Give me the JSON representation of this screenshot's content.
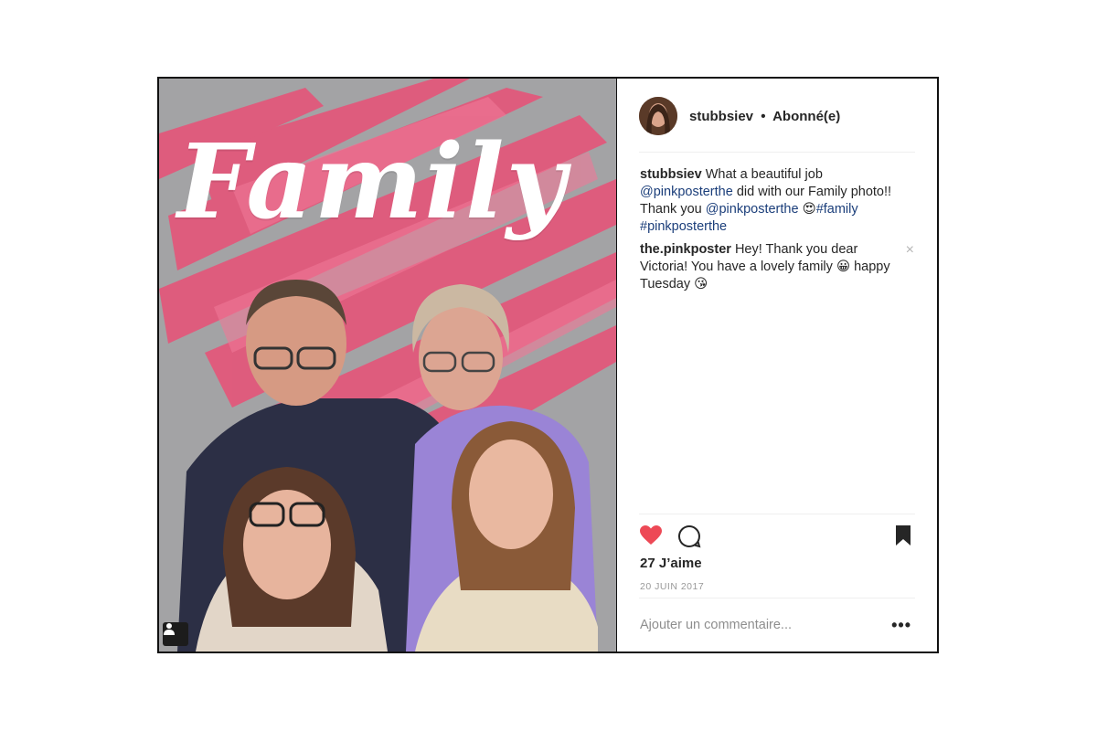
{
  "post": {
    "header": {
      "username": "stubbsiev",
      "separator": "•",
      "follow_status": "Abonné(e)"
    },
    "image": {
      "overlay_word": "Family",
      "tag_icon": "user-tag-icon"
    },
    "comments": [
      {
        "user": "stubbsiev",
        "text_1": "What a beautiful job",
        "mention_1": "@pinkposterthe",
        "text_2": "did with our Family photo!! Thank you",
        "mention_2": "@pinkposterthe",
        "emoji": "😍",
        "hashtag_1": "#family",
        "hashtag_2": "#pinkposterthe"
      },
      {
        "user": "the.pinkposter",
        "text_1": "Hey! Thank you dear Victoria! You have a lovely family",
        "emoji_1": "😀",
        "text_2": "happy Tuesday",
        "emoji_2": "😘",
        "close_icon": "×"
      }
    ],
    "actions": {
      "liked": true,
      "like_color": "#ed4956",
      "saved": true
    },
    "likes_label": "27 J’aime",
    "date": "20 JUIN 2017",
    "add_comment_placeholder": "Ajouter un commentaire...",
    "more_icon": "•••"
  }
}
